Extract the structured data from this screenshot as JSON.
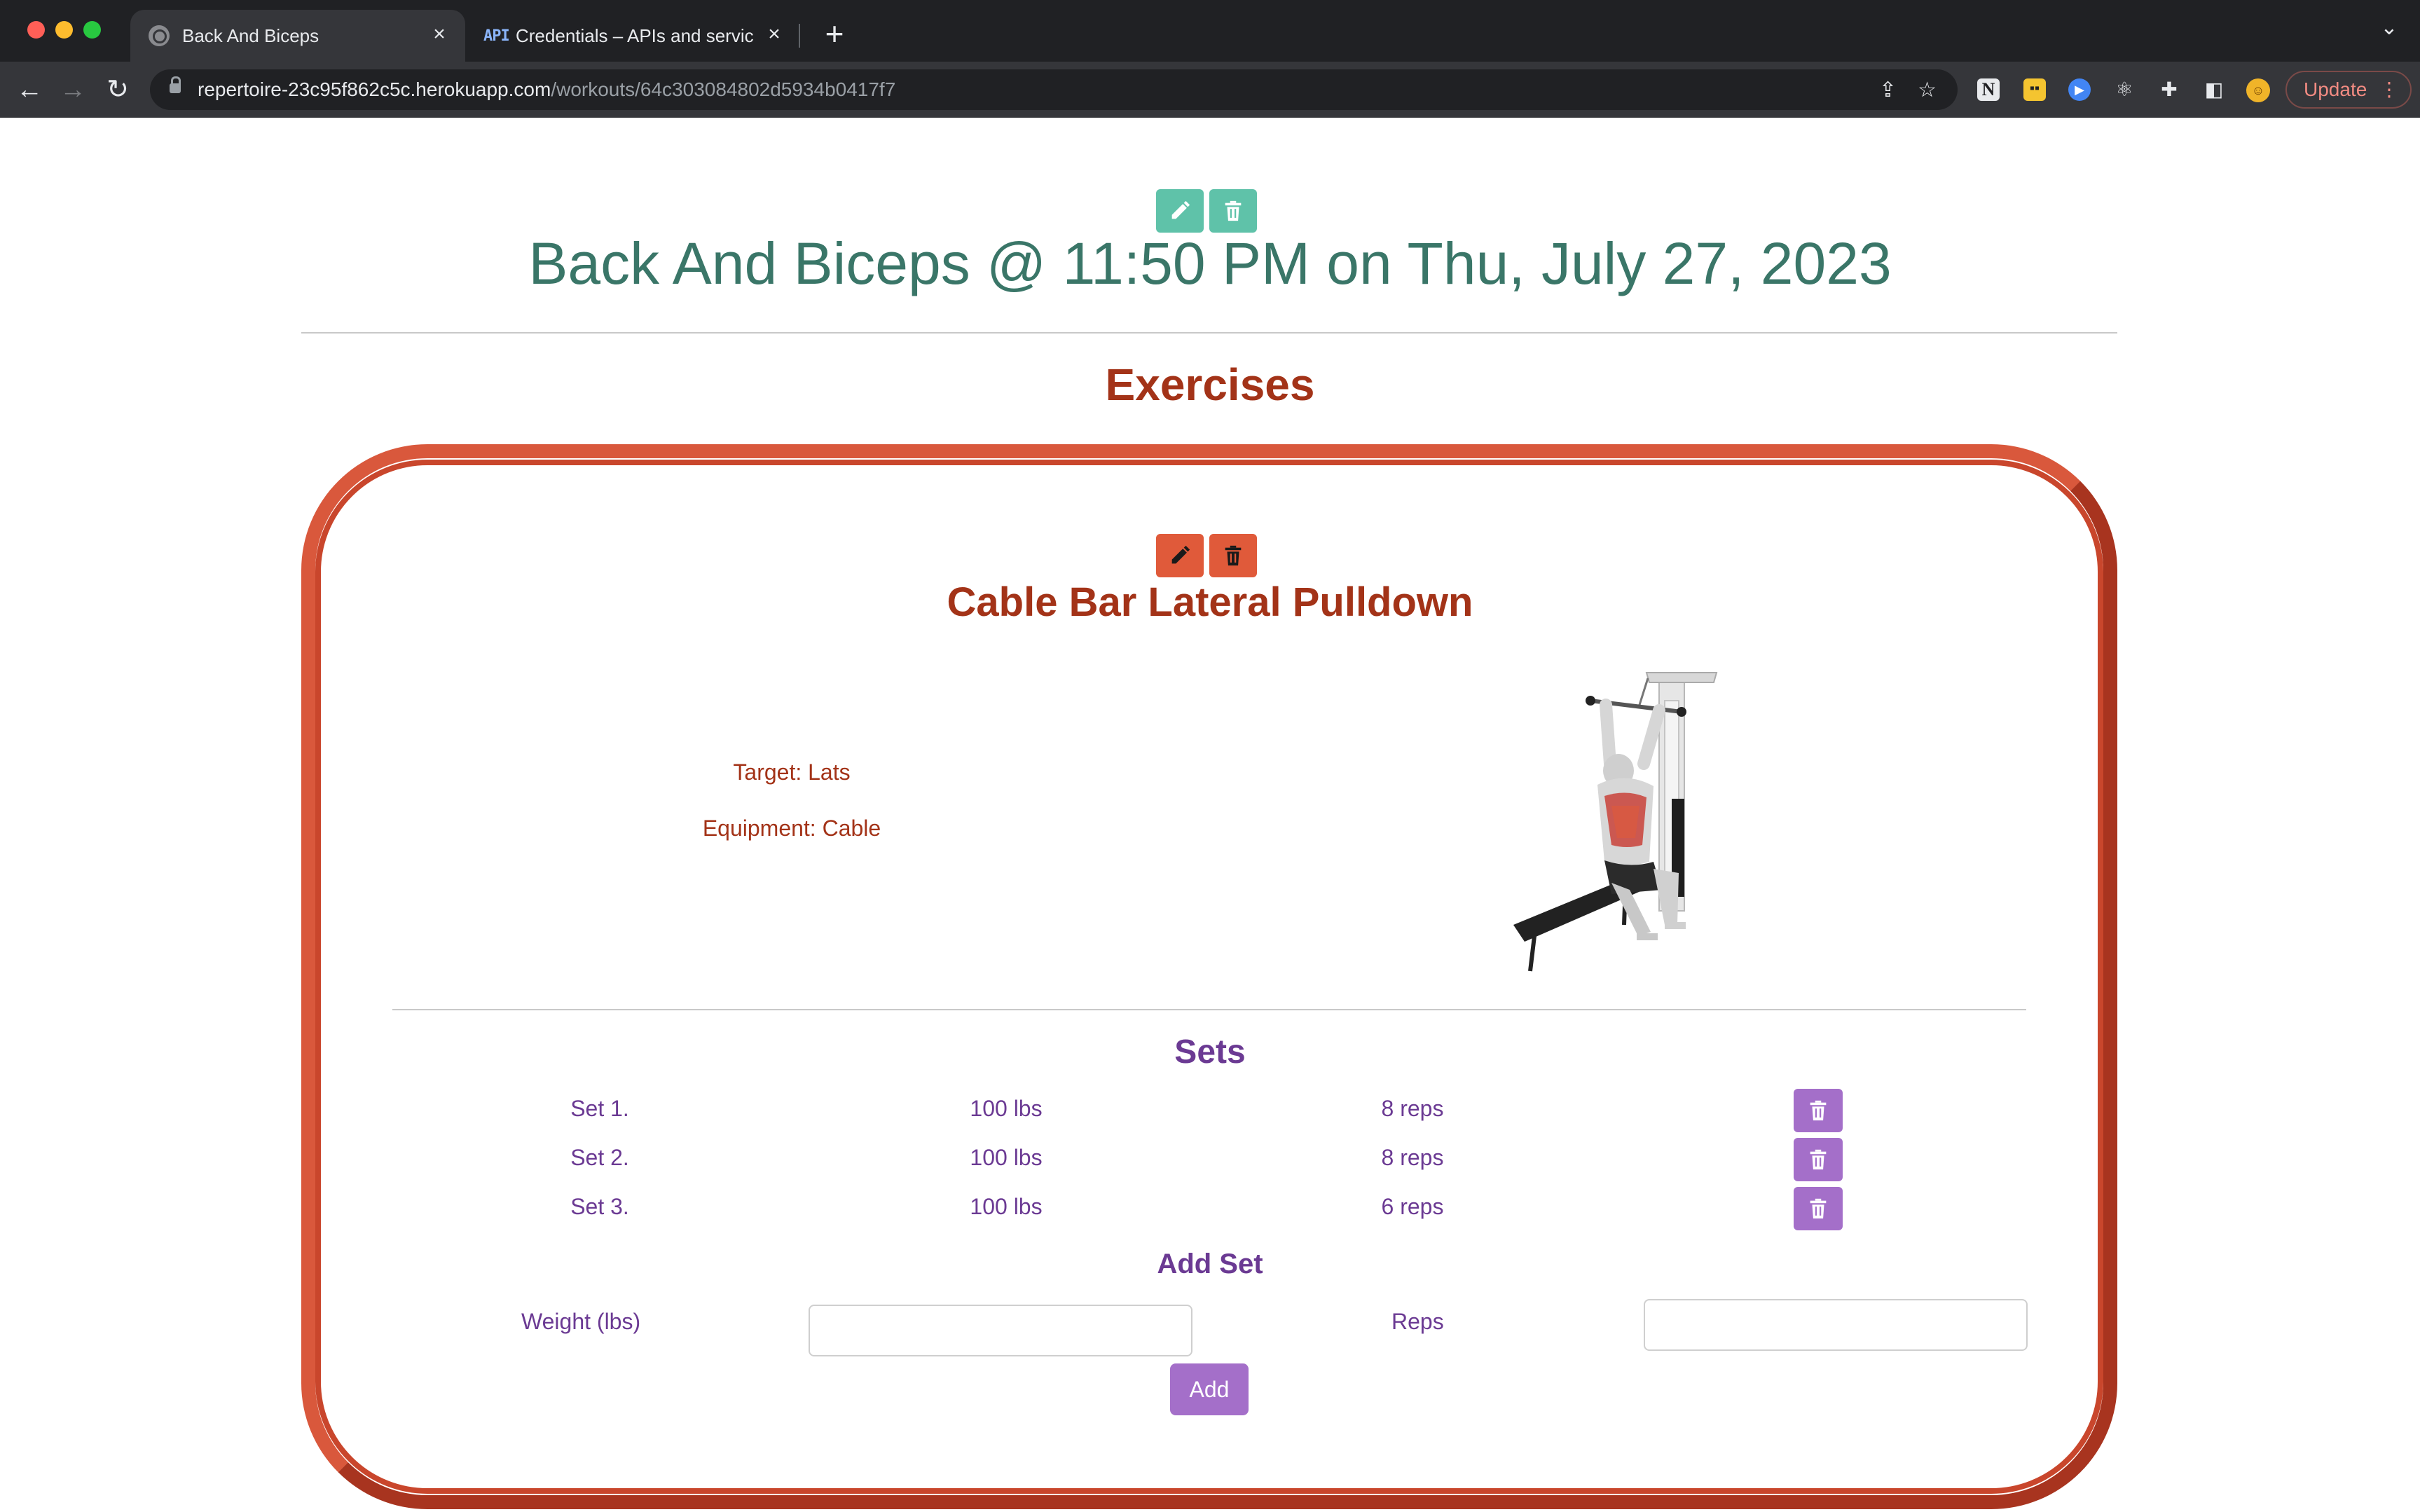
{
  "browser": {
    "tabs": [
      {
        "title": "Back And Biceps",
        "active": true
      },
      {
        "title": "Credentials – APIs and services",
        "favicon_text": "API",
        "active": false
      }
    ],
    "url": {
      "host": "repertoire-23c95f862c5c.herokuapp.com",
      "path": "/workouts/64c303084802d5934b0417f7"
    },
    "update_label": "Update"
  },
  "workout": {
    "title": "Back And Biceps @ 11:50 PM on Thu, July 27, 2023"
  },
  "exercises_heading": "Exercises",
  "exercise": {
    "name": "Cable Bar Lateral Pulldown",
    "target": "Target: Lats",
    "equipment": "Equipment: Cable",
    "sets_heading": "Sets",
    "sets": [
      {
        "name": "Set 1.",
        "weight": "100 lbs",
        "reps": "8 reps"
      },
      {
        "name": "Set 2.",
        "weight": "100 lbs",
        "reps": "8 reps"
      },
      {
        "name": "Set 3.",
        "weight": "100 lbs",
        "reps": "6 reps"
      }
    ],
    "add_set": {
      "heading": "Add Set",
      "weight_label": "Weight (lbs)",
      "reps_label": "Reps",
      "weight_value": "",
      "reps_value": "",
      "add_label": "Add"
    }
  },
  "colors": {
    "workout_teal": "#3a7668",
    "button_teal": "#5fc2a9",
    "exercise_red": "#a33318",
    "button_orange": "#e05a3a",
    "sets_purple": "#6b3a93",
    "button_purple": "#a46fc9"
  },
  "icons": {
    "edit": "pencil-icon",
    "delete": "trash-icon"
  }
}
